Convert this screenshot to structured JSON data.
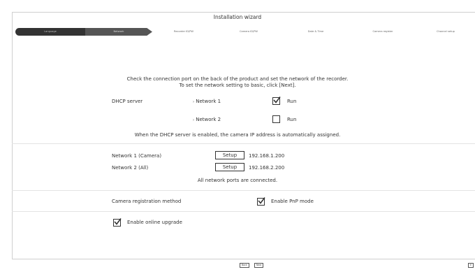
{
  "window": {
    "title": "Installation wizard"
  },
  "steps": [
    {
      "label": "Language",
      "state": "done"
    },
    {
      "label": "Network",
      "state": "active"
    },
    {
      "label": "Recorder ID/PW",
      "state": "todo"
    },
    {
      "label": "Camera ID/PW",
      "state": "todo"
    },
    {
      "label": "Date & Time",
      "state": "todo"
    },
    {
      "label": "Camera register",
      "state": "todo"
    },
    {
      "label": "Channel setup",
      "state": "todo"
    }
  ],
  "instructions": {
    "line1": "Check the connection port on the back of the product and set the network of the recorder.",
    "line2": "To set the network setting to basic, click [Next]."
  },
  "dhcp": {
    "label": "DHCP server",
    "rows": [
      {
        "network": "Network 1",
        "option": "Run",
        "checked": true
      },
      {
        "network": "Network 2",
        "option": "Run",
        "checked": false
      }
    ],
    "note": "When the DHCP server is enabled, the camera IP address is automatically assigned."
  },
  "networks": {
    "rows": [
      {
        "label": "Network 1 (Camera)",
        "button": "Setup",
        "ip": "192.168.1.200"
      },
      {
        "label": "Network 2 (All)",
        "button": "Setup",
        "ip": "192.168.2.200"
      }
    ],
    "status": "All network ports are connected."
  },
  "camera_registration": {
    "label": "Camera registration method",
    "option": "Enable PnP mode",
    "checked": true
  },
  "online_upgrade": {
    "label": "Enable online upgrade",
    "checked": true
  },
  "footer": {
    "back": "Back",
    "next": "Next",
    "exit": "E"
  }
}
